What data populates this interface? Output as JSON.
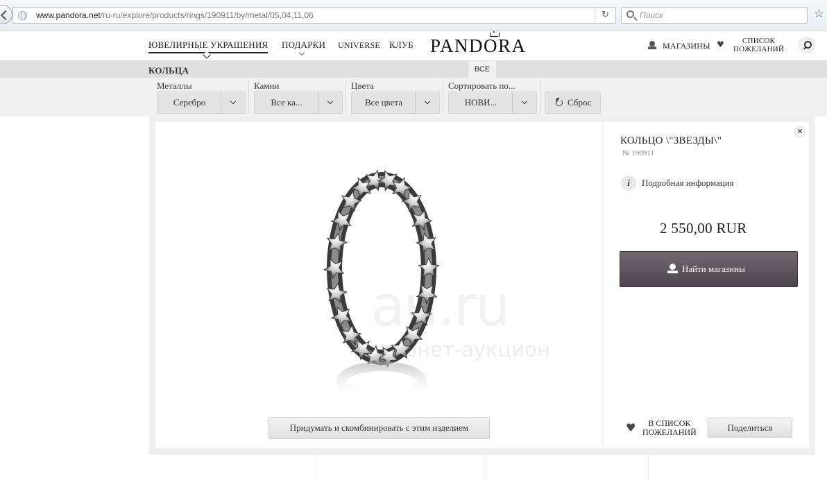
{
  "browser": {
    "url_domain": "www.pandora.net",
    "url_path": "/ru-ru/explore/products/rings/190911/by/metal/05,04,11,06",
    "search_placeholder": "Поиск"
  },
  "header": {
    "nav": {
      "jewelry": "ЮВЕЛИРНЫЕ УКРАШЕНИЯ",
      "gifts": "ПОДАРКИ",
      "universe": "UNIVERSE",
      "club": "КЛУБ"
    },
    "logo": "PANDORA",
    "stores": "МАГАЗИНЫ",
    "wishlist_line1": "СПИСОК",
    "wishlist_line2": "ПОЖЕЛАНИЙ"
  },
  "category": {
    "title": "КОЛЬЦА",
    "tab_all": "ВСЕ"
  },
  "filters": [
    {
      "label": "Металлы",
      "value": "Серебро"
    },
    {
      "label": "Камни",
      "value": "Все ка..."
    },
    {
      "label": "Цвета",
      "value": "Все цвета"
    },
    {
      "label": "Сортировать по...",
      "value": "НОВИ..."
    }
  ],
  "reset_label": "Сброс",
  "product": {
    "title": "КОЛЬЦО \\\"ЗВЕЗДЫ\\\"",
    "sku": "№ 190911",
    "details_link": "Подробная информация",
    "price": "2 550,00 RUR",
    "find_stores": "Найти магазины",
    "combine": "Придумать и скомбинировать с этим изделием",
    "add_wishlist_line1": "В СПИСОК",
    "add_wishlist_line2": "ПОЖЕЛАНИЙ",
    "share": "Поделиться"
  },
  "watermark": {
    "big": "au.ru",
    "small": "интернет-аукцион"
  },
  "colors": {
    "accent_button": "#5e555e",
    "filter_bg": "#f1f1f1",
    "category_bar": "#dfdfdf"
  }
}
